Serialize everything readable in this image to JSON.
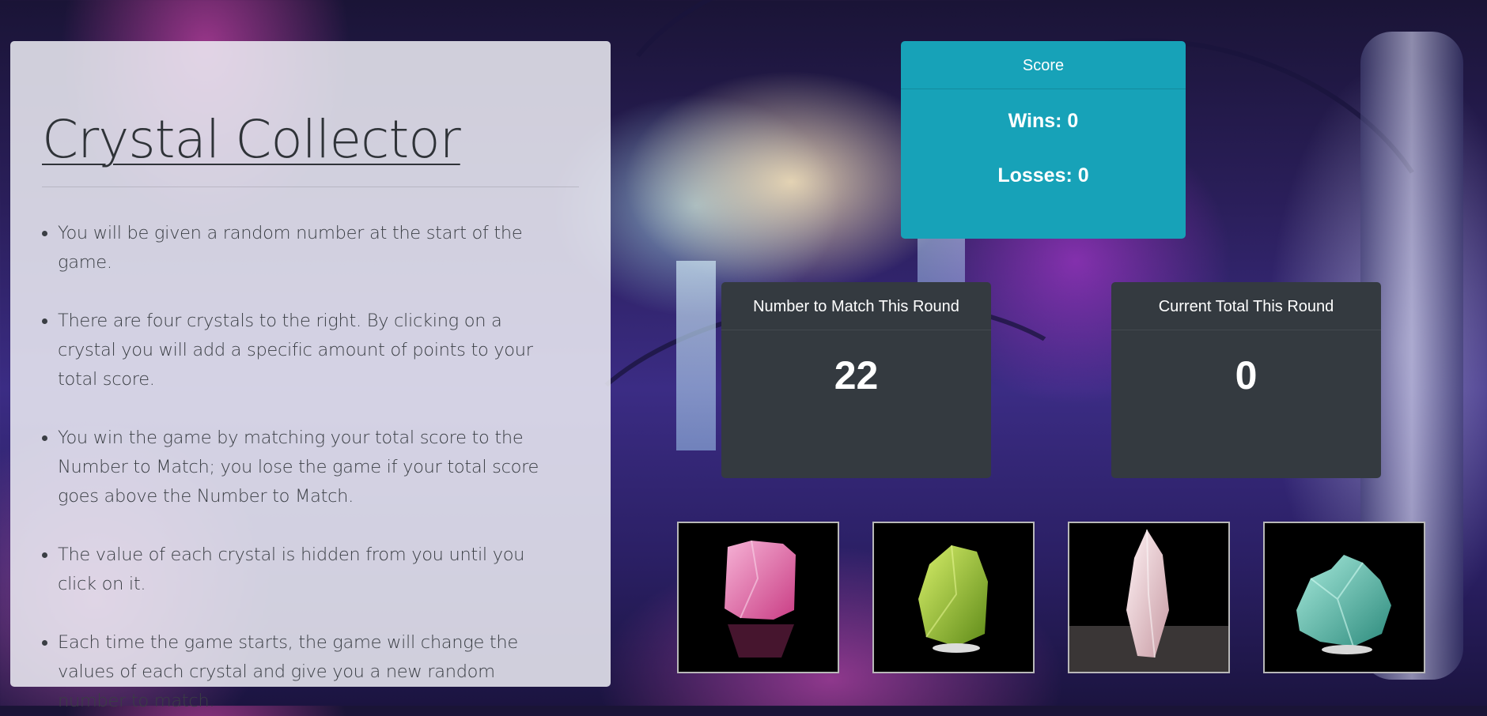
{
  "app": {
    "title": "Crystal Collector"
  },
  "rules": [
    "You will be given a random number at the start of the game.",
    "There are four crystals to the right. By clicking on a crystal you will add a specific amount of points to your total score.",
    "You win the game by matching your total score to the Number to Match; you lose the game if your total score goes above the Number to Match.",
    "The value of each crystal is hidden from you until you click on it.",
    "Each time the game starts, the game will change the values of each crystal and give you a new random number to match."
  ],
  "score": {
    "header": "Score",
    "wins": "Wins: 0",
    "losses": "Losses: 0"
  },
  "match": {
    "header": "Number to Match This Round",
    "value": "22"
  },
  "total": {
    "header": "Current Total This Round",
    "value": "0"
  },
  "crystals": [
    {
      "name": "pink-crystal",
      "color": "#e86aa8"
    },
    {
      "name": "green-crystal",
      "color": "#9cc83a"
    },
    {
      "name": "clear-crystal",
      "color": "#e8cdd2"
    },
    {
      "name": "teal-crystal",
      "color": "#5fbfae"
    }
  ],
  "colors": {
    "score_card": "#17a2b8",
    "dark_card": "#343a40",
    "panel": "#eeeef4"
  }
}
